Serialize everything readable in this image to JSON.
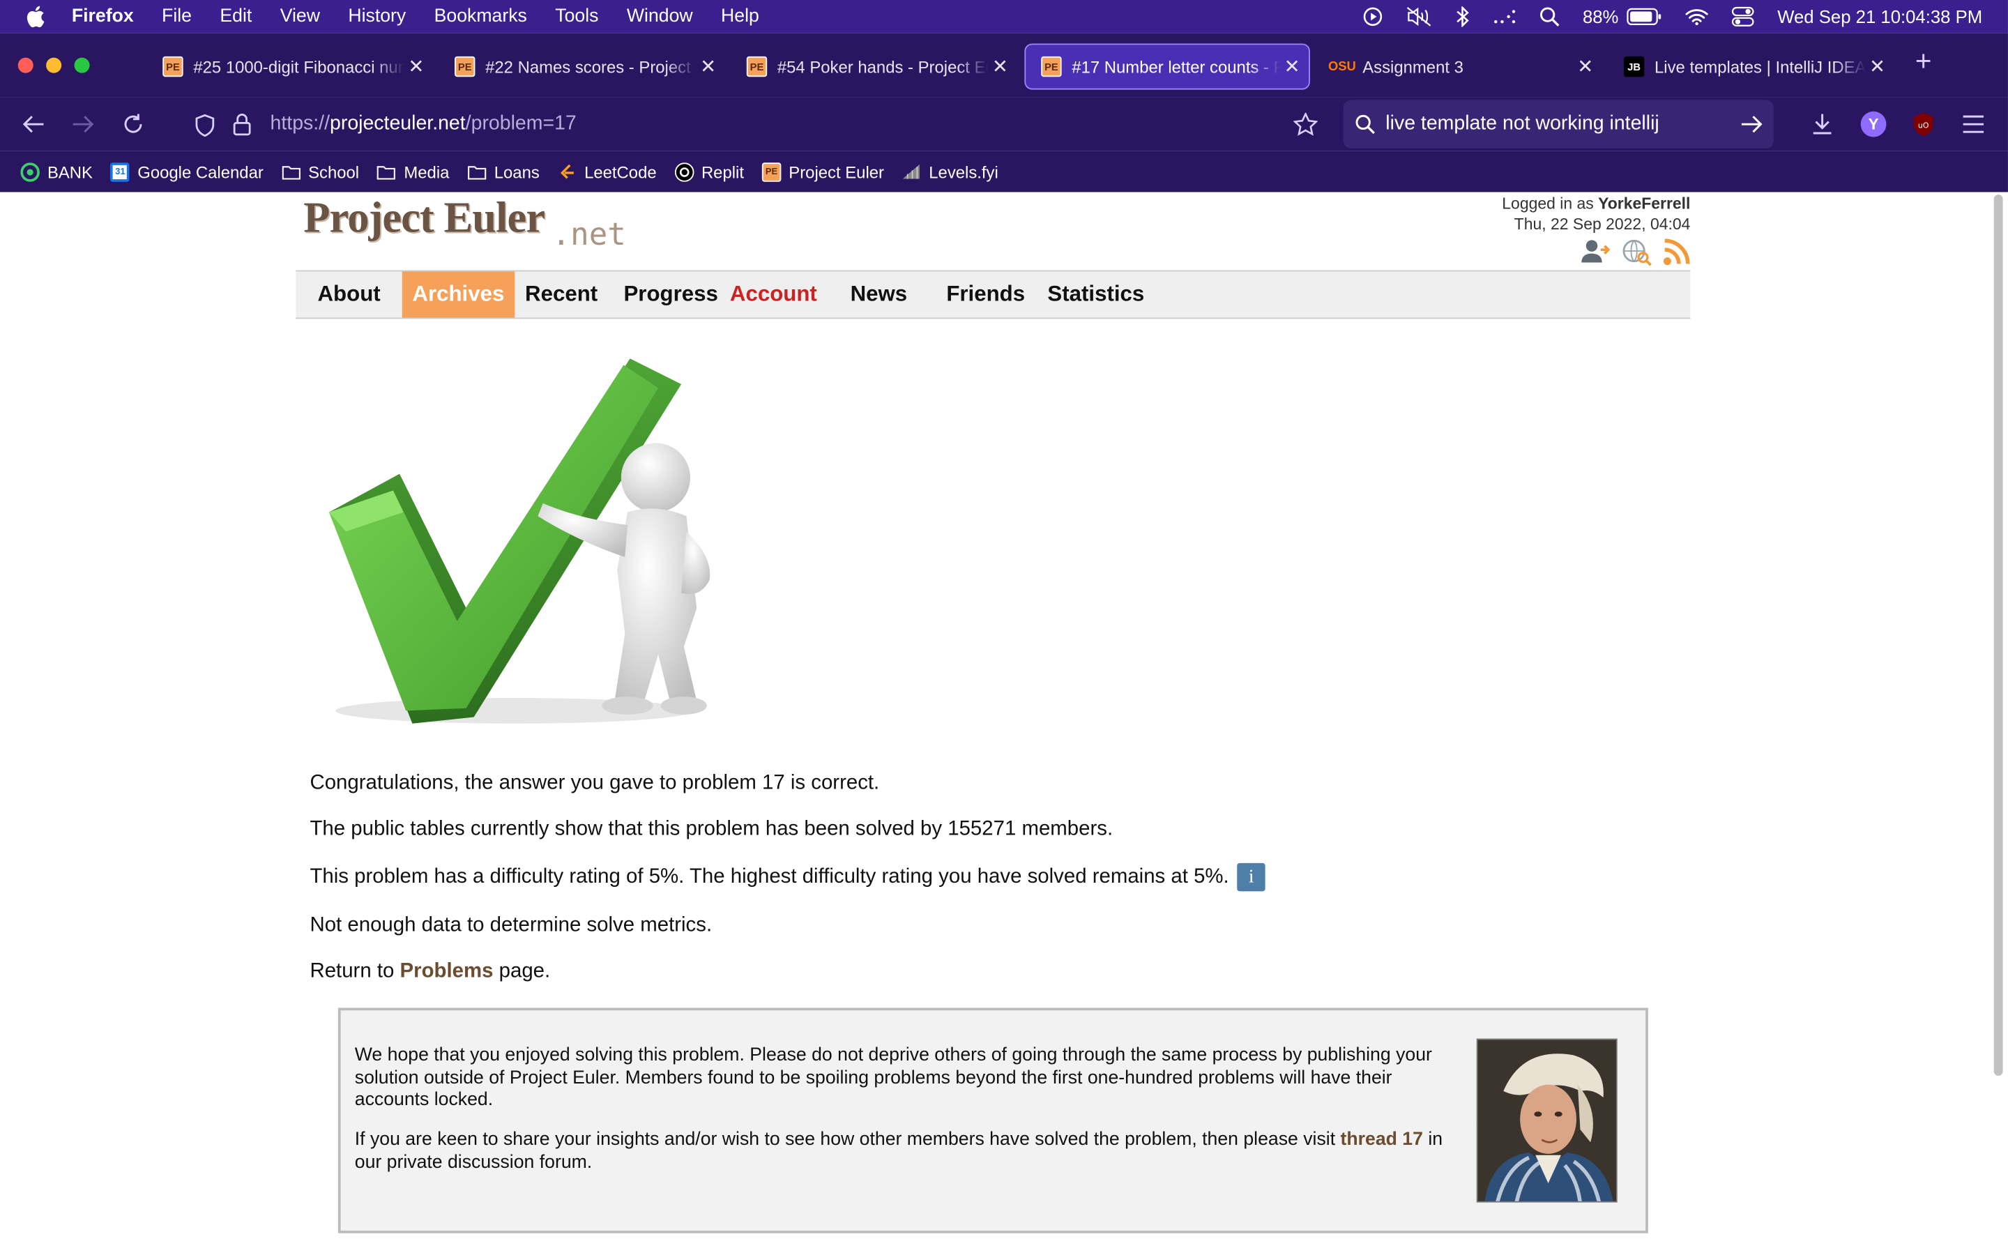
{
  "menubar": {
    "items": [
      "Firefox",
      "File",
      "Edit",
      "View",
      "History",
      "Bookmarks",
      "Tools",
      "Window",
      "Help"
    ],
    "battery": "88%",
    "clock": "Wed Sep 21  10:04:38 PM"
  },
  "tabs": [
    {
      "title": "#25 1000-digit Fibonacci number",
      "favicon": "PE",
      "active": false
    },
    {
      "title": "#22 Names scores - Project Euler",
      "favicon": "PE",
      "active": false
    },
    {
      "title": "#54 Poker hands - Project Euler",
      "favicon": "PE",
      "active": false
    },
    {
      "title": "#17 Number letter counts - Project Euler",
      "favicon": "PE",
      "active": true
    },
    {
      "title": "Assignment 3",
      "favicon": "OSU",
      "active": false
    },
    {
      "title": "Live templates | IntelliJ IDEA",
      "favicon": "JB",
      "active": false
    }
  ],
  "navbar": {
    "url_scheme": "https://",
    "url_host": "projecteuler.net",
    "url_path": "/problem=17",
    "search_text": "live template not working intellij",
    "profile_initial": "Y"
  },
  "bookmarks": [
    {
      "label": "BANK",
      "icon": "bank-icon"
    },
    {
      "label": "Google Calendar",
      "icon": "calendar-icon"
    },
    {
      "label": "School",
      "icon": "folder-icon"
    },
    {
      "label": "Media",
      "icon": "folder-icon"
    },
    {
      "label": "Loans",
      "icon": "folder-icon"
    },
    {
      "label": "LeetCode",
      "icon": "leetcode-icon"
    },
    {
      "label": "Replit",
      "icon": "replit-icon"
    },
    {
      "label": "Project Euler",
      "icon": "pe-icon"
    },
    {
      "label": "Levels.fyi",
      "icon": "levels-icon"
    }
  ],
  "site": {
    "logo_main": "Project Euler",
    "logo_suffix": ".net",
    "logged_in_prefix": "Logged in as ",
    "username": "YorkeFerrell",
    "datetime": "Thu, 22 Sep 2022, 04:04",
    "nav": [
      "About",
      "Archives",
      "Recent",
      "Progress",
      "Account",
      "News",
      "Friends",
      "Statistics"
    ]
  },
  "result": {
    "congrats": "Congratulations, the answer you gave to problem 17 is correct.",
    "solved_by": "The public tables currently show that this problem has been solved by 155271 members.",
    "difficulty": "This problem has a difficulty rating of 5%. The highest difficulty rating you have solved remains at 5%.",
    "info_icon": "i",
    "metrics": "Not enough data to determine solve metrics.",
    "return_prefix": "Return to ",
    "return_link": "Problems",
    "return_suffix": " page."
  },
  "note": {
    "p1": "We hope that you enjoyed solving this problem. Please do not deprive others of going through the same process by publishing your solution outside of Project Euler. Members found to be spoiling problems beyond the first one-hundred problems will have their accounts locked.",
    "p2_prefix": "If you are keen to share your insights and/or wish to see how other members have solved the problem, then please visit ",
    "p2_link": "thread 17",
    "p2_suffix": " in our private discussion forum."
  },
  "colors": {
    "menubar": "#3b1f8f",
    "toolbar": "#2a1660",
    "active_tab": "#4a2fb4",
    "archives_highlight": "#f5a15a",
    "account_red": "#cc2222",
    "link_brown": "#6b4c2e"
  }
}
